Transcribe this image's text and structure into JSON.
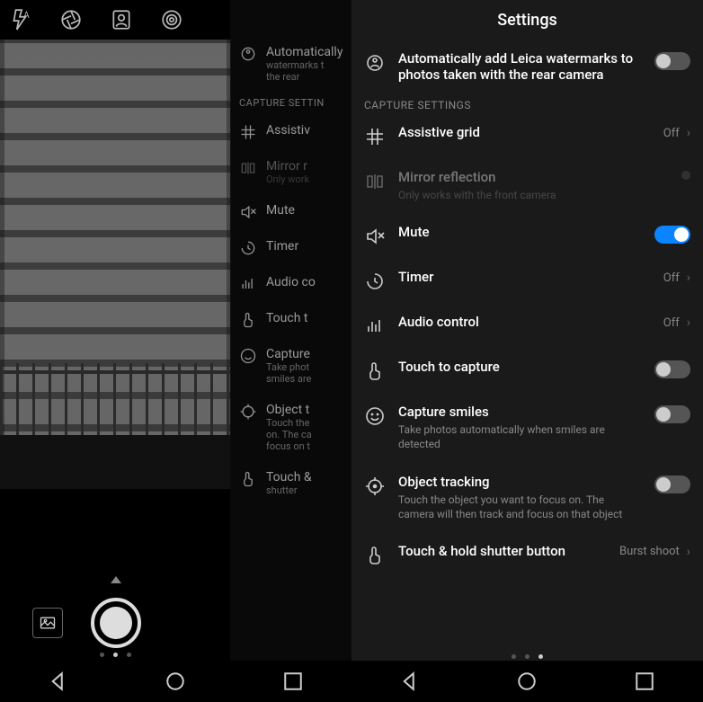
{
  "right": {
    "header": "Settings",
    "watermark": {
      "title": "Automatically add Leica watermarks to photos taken with the rear camera",
      "on": false
    },
    "section_capture": "CAPTURE SETTINGS",
    "assistive_grid": {
      "title": "Assistive grid",
      "value": "Off"
    },
    "mirror": {
      "title": "Mirror reflection",
      "sub": "Only works with the front camera"
    },
    "mute": {
      "title": "Mute",
      "on": true
    },
    "timer": {
      "title": "Timer",
      "value": "Off"
    },
    "audio_control": {
      "title": "Audio control",
      "value": "Off"
    },
    "touch_capture": {
      "title": "Touch to capture",
      "on": false
    },
    "capture_smiles": {
      "title": "Capture smiles",
      "sub": "Take photos automatically when smiles are detected",
      "on": false
    },
    "object_tracking": {
      "title": "Object tracking",
      "sub": "Touch the object you want to focus on. The camera will then track and focus on that object",
      "on": false
    },
    "touch_hold": {
      "title": "Touch & hold shutter button",
      "value": "Burst shoot"
    }
  },
  "left_overlay": {
    "watermark_line1": "Automatically",
    "watermark_line2": "watermarks t",
    "watermark_line3": "the rear",
    "section_capture": "CAPTURE SETTIN",
    "assistive": "Assistiv",
    "mirror": "Mirror r",
    "mirror_sub": "Only work",
    "mute": "Mute",
    "timer": "Timer",
    "audio": "Audio co",
    "touch": "Touch t",
    "smiles": "Capture",
    "smiles_sub": "Take phot",
    "smiles_sub2": "smiles are",
    "obj": "Object t",
    "obj_sub": "Touch the",
    "obj_sub2": "on. The ca",
    "obj_sub3": "focus on t",
    "touch_hold": "Touch &",
    "touch_hold2": "shutter"
  }
}
